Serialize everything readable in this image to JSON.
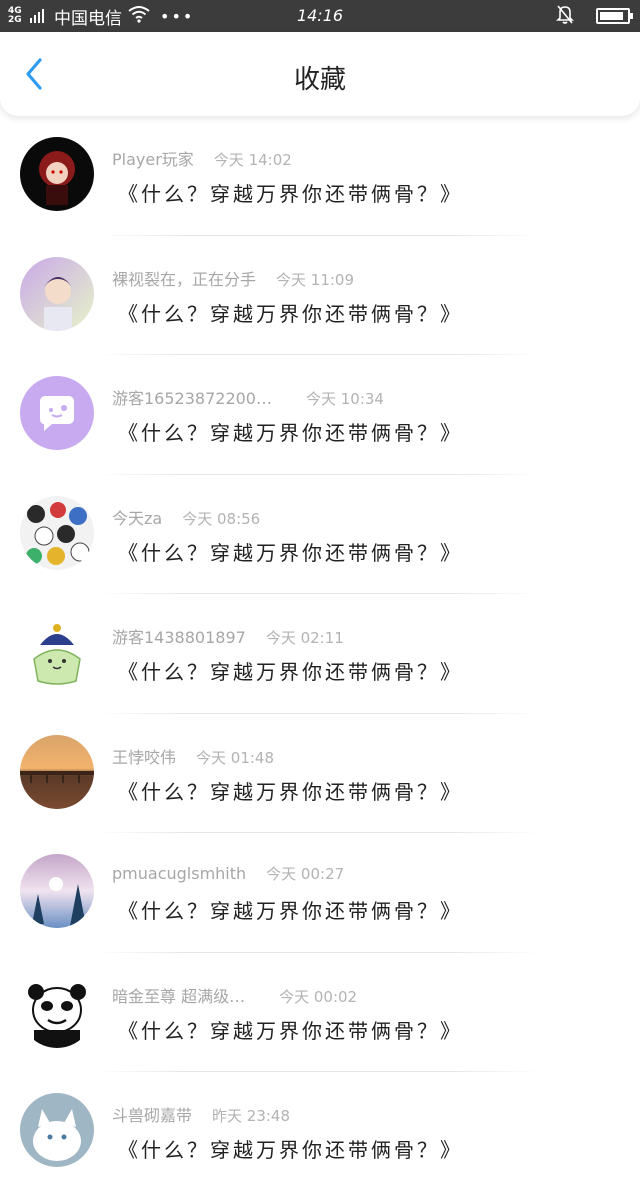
{
  "status_bar": {
    "network": "4G\n2G",
    "carrier": "中国电信",
    "more": "•••",
    "time": "14:16",
    "battery_level": 0.9
  },
  "header": {
    "title": "收藏",
    "back_icon": "chevron-left-icon",
    "accent_color": "#2e9cf0"
  },
  "items": [
    {
      "name": "Player玩家",
      "time": "今天 14:02",
      "text": "《什么？穿越万界你还带俩骨？》"
    },
    {
      "name": "裸视裂在，正在分手",
      "time": "今天 11:09",
      "text": "《什么？穿越万界你还带俩骨？》"
    },
    {
      "name": "游客16523872200…",
      "time": "今天 10:34",
      "text": "《什么？穿越万界你还带俩骨？》"
    },
    {
      "name": "今天za",
      "time": "今天 08:56",
      "text": "《什么？穿越万界你还带俩骨？》"
    },
    {
      "name": "游客1438801897",
      "time": "今天 02:11",
      "text": "《什么？穿越万界你还带俩骨？》"
    },
    {
      "name": "王悖咬伟",
      "time": "今天 01:48",
      "text": "《什么？穿越万界你还带俩骨？》"
    },
    {
      "name": "pmuacuglsmhith",
      "time": "今天 00:27",
      "text": "《什么？穿越万界你还带俩骨？》"
    },
    {
      "name": "暗金至尊 超满级…",
      "time": "今天 00:02",
      "text": "《什么？穿越万界你还带俩骨？》"
    },
    {
      "name": "斗兽砌嘉带",
      "time": "昨天 23:48",
      "text": "《什么？穿越万界你还带俩骨？》"
    }
  ]
}
